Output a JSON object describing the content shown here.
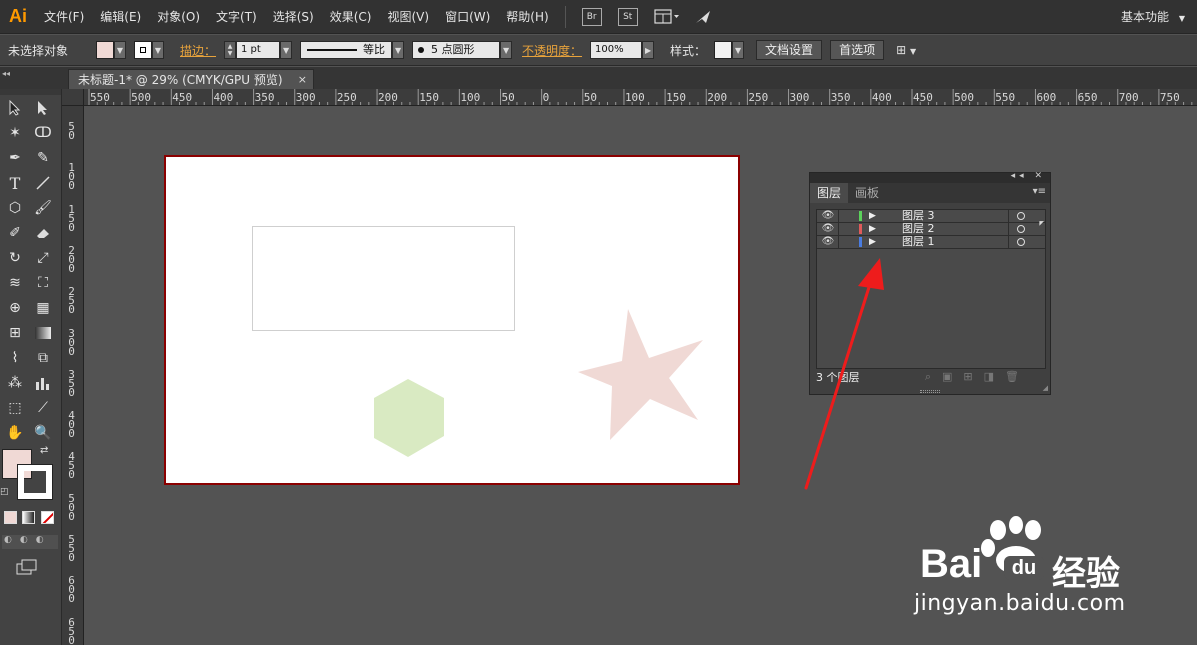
{
  "app": {
    "logo": "Ai",
    "menu": [
      "文件(F)",
      "编辑(E)",
      "对象(O)",
      "文字(T)",
      "选择(S)",
      "效果(C)",
      "视图(V)",
      "窗口(W)",
      "帮助(H)"
    ],
    "bridge_label": "Br",
    "stock_label": "St",
    "workspace": "基本功能"
  },
  "control_bar": {
    "selection_status": "未选择对象",
    "fill_color": "#f0d9d5",
    "stroke_label": "描边：",
    "stroke_weight": "1 pt",
    "stroke_profile": "等比",
    "brush": "5 点圆形",
    "opacity_label": "不透明度：",
    "opacity_value": "100%",
    "style_label": "样式：",
    "doc_setup_button": "文档设置",
    "prefs_button": "首选项"
  },
  "document": {
    "tab_title": "未标题-1* @ 29% (CMYK/GPU 预览)",
    "tab_close": "×",
    "ruler_top_labels": [
      "550",
      "500",
      "450",
      "400",
      "350",
      "300",
      "250",
      "200",
      "150",
      "100",
      "50",
      "0",
      "50",
      "100",
      "150",
      "200",
      "250",
      "300",
      "350",
      "400",
      "450",
      "500",
      "550",
      "600",
      "650",
      "700",
      "750"
    ],
    "ruler_left_labels": [
      "50",
      "100",
      "150",
      "200",
      "250",
      "300",
      "350",
      "400",
      "450",
      "500",
      "550",
      "600",
      "650"
    ]
  },
  "artwork": {
    "hexagon_color": "#d9eac2",
    "star_color": "#f0d9d5",
    "rect_stroke_color": "#cfcfcf",
    "artboard_border": "#8b0000"
  },
  "layers_panel": {
    "tabs": [
      "图层",
      "画板"
    ],
    "active_tab": "图层",
    "layers": [
      {
        "name": "图层 3",
        "color": "#5bd15b"
      },
      {
        "name": "图层 2",
        "color": "#e05a5a"
      },
      {
        "name": "图层 1",
        "color": "#4a7ce0"
      }
    ],
    "footer_count": "3 个图层"
  },
  "watermark": {
    "brand": "Bai",
    "brand_suffix": "经验",
    "url": "jingyan.baidu.com"
  }
}
